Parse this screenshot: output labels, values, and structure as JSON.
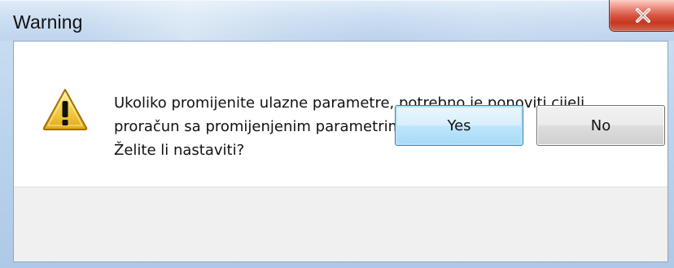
{
  "window": {
    "title": "Warning"
  },
  "dialog": {
    "icon": "warning-triangle-icon",
    "message_lines": [
      "Ukoliko promijenite ulazne parametre, potrebno je ponoviti cijeli",
      "proračun sa promijenjenim parametrima!",
      "Želite li nastaviti?"
    ]
  },
  "buttons": {
    "yes": "Yes",
    "no": "No"
  },
  "colors": {
    "close_button": "#c7361f",
    "primary_button_border": "#3c7fb1",
    "warning_fill": "#f2c535"
  }
}
